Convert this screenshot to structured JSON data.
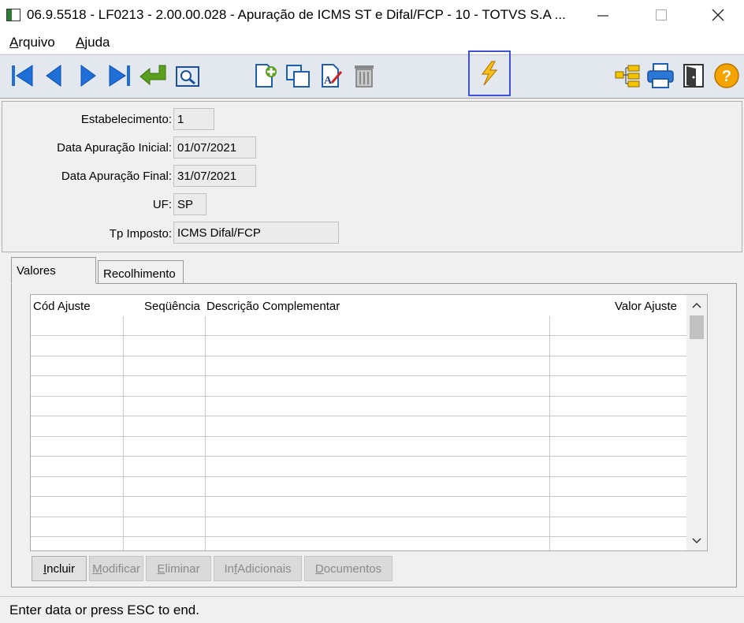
{
  "window": {
    "title": "06.9.5518 - LF0213 - 2.00.00.028 - Apuração de ICMS ST e Difal/FCP - 10 - TOTVS S.A ..."
  },
  "menu": {
    "arquivo": {
      "first": "A",
      "rest": "rquivo"
    },
    "ajuda": {
      "first": "A",
      "rest": "juda"
    }
  },
  "toolbar": {
    "icons": [
      "first-icon",
      "prev-icon",
      "next-icon",
      "last-icon",
      "goto-icon",
      "search-zoom-icon",
      "new-icon",
      "copy-icon",
      "edit-icon",
      "delete-icon",
      "execute-lightning-icon",
      "tree-icon",
      "print-icon",
      "exit-door-icon",
      "help-icon"
    ]
  },
  "form": {
    "estabelecimento": {
      "label": "Estabelecimento:",
      "value": "1"
    },
    "data_inicial": {
      "label": "Data Apuração Inicial:",
      "value": "01/07/2021"
    },
    "data_final": {
      "label": "Data Apuração Final:",
      "value": "31/07/2021"
    },
    "uf": {
      "label": "UF:",
      "value": "SP"
    },
    "tp_imposto": {
      "label": "Tp Imposto:",
      "value": "ICMS Difal/FCP"
    }
  },
  "tabs": {
    "valores": "Valores",
    "recolhimento": "Recolhimento"
  },
  "grid": {
    "columns": [
      "Cód Ajuste",
      "Seqüência",
      "Descrição Complementar",
      "Valor Ajuste"
    ]
  },
  "buttons": {
    "incluir": {
      "before": "",
      "u": "I",
      "after": "ncluir"
    },
    "modificar": {
      "before": "",
      "u": "M",
      "after": "odificar"
    },
    "eliminar": {
      "before": "",
      "u": "E",
      "after": "liminar"
    },
    "inf_adicionais": {
      "before": "In",
      "u": "f",
      "after": " Adicionais"
    },
    "documentos": {
      "before": "",
      "u": "D",
      "after": "ocumentos"
    }
  },
  "status": {
    "text": "Enter data or press ESC to end."
  },
  "colors": {
    "highlight_border": "#3f51d6",
    "nav_blue": "#1f6fd8",
    "goto_green": "#5aa01e",
    "help_orange": "#f5a300"
  }
}
